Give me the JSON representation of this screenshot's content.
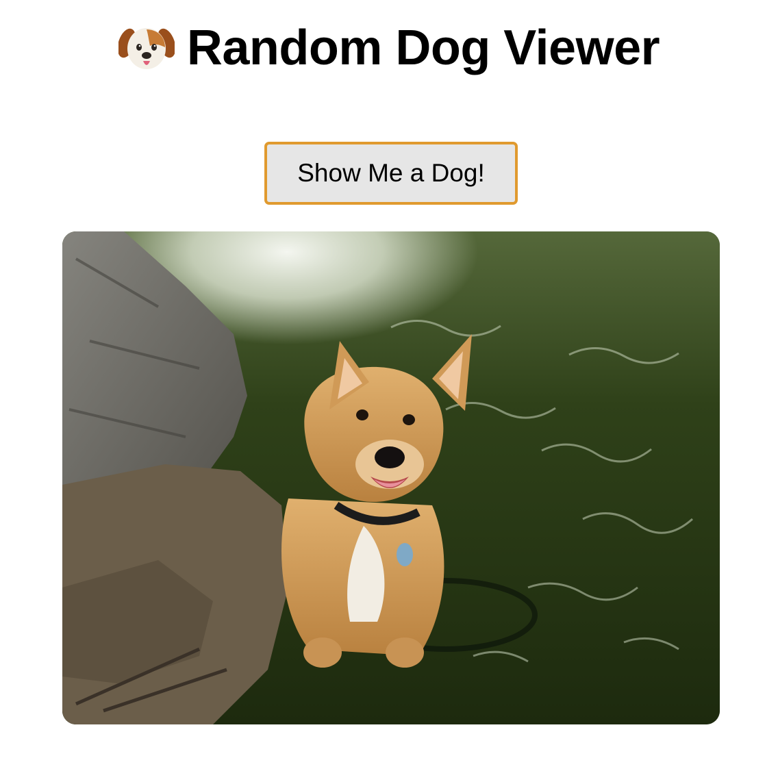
{
  "header": {
    "title": "Random Dog Viewer",
    "icon": "dog-face-icon"
  },
  "controls": {
    "fetch_button_label": "Show Me a Dog!"
  },
  "image": {
    "subject": "dog-photo",
    "colors": {
      "water": "#2b3b16",
      "rock": "#6e6c66",
      "fur": "#d4a05e",
      "button_border": "#e09a2f",
      "button_bg": "#e6e6e6"
    }
  }
}
